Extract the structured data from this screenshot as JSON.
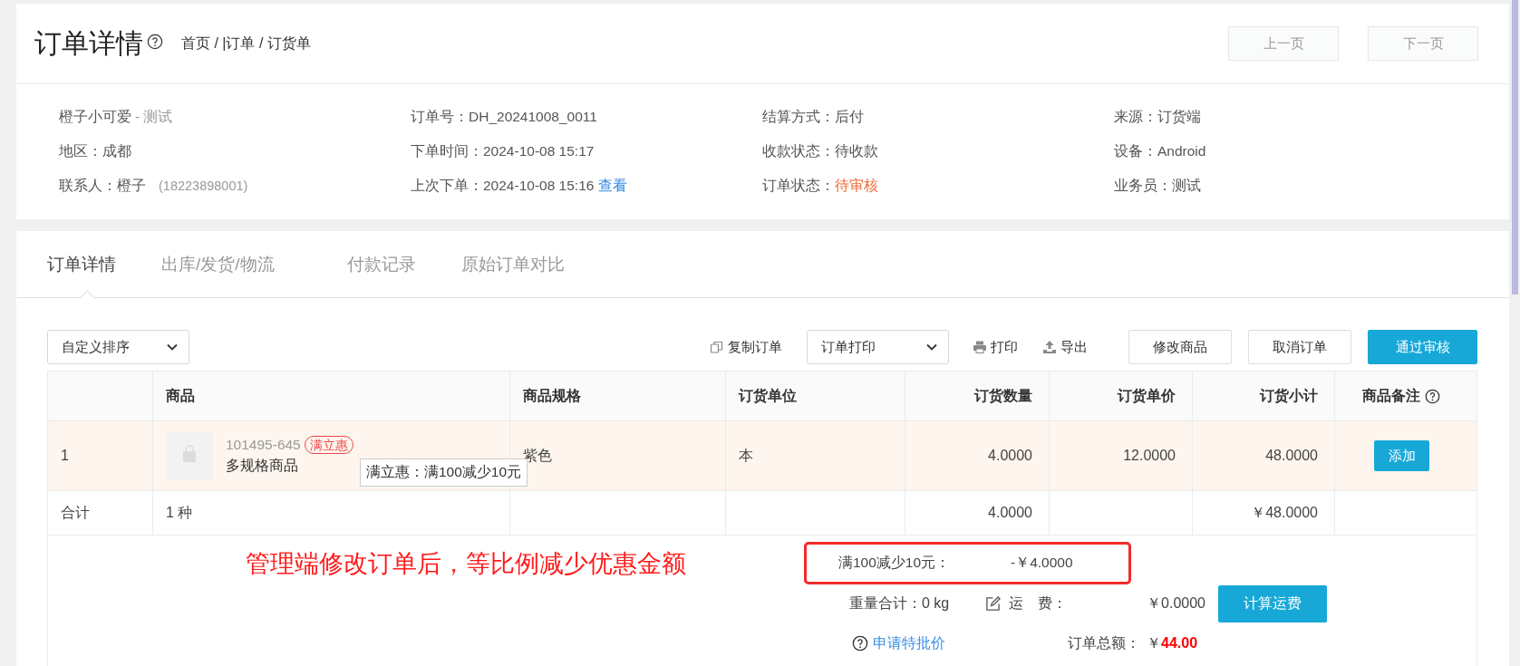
{
  "header": {
    "title": "订单详情",
    "breadcrumb": "首页 / |订单 / 订货单",
    "buttons": [
      "上一页",
      "下一页"
    ]
  },
  "info": [
    {
      "value": "橙子小可爱",
      "note": "- 测试",
      "highlight": false
    },
    {
      "label": "订单号：",
      "value": "DH_20241008_0011",
      "highlight": false
    },
    {
      "label": "结算方式：",
      "value": "后付",
      "highlight": false
    },
    {
      "label": "来源：",
      "value": "订货端",
      "highlight": false
    },
    {
      "label": "地区：",
      "value": "成都",
      "highlight": false
    },
    {
      "label": "下单时间：",
      "value": "2024-10-08 15:17",
      "highlight": false
    },
    {
      "label": "收款状态：",
      "value": "待收款",
      "highlight": false
    },
    {
      "label": "设备：",
      "value": "Android",
      "highlight": false
    },
    {
      "label": "联系人：",
      "value": "橙子",
      "note": "(18223898001)",
      "highlight": false
    },
    {
      "label": "上次下单：",
      "value": "2024-10-08 15:16",
      "link": "查看",
      "highlight": false
    },
    {
      "label": "订单状态：",
      "value": "待审核",
      "highlight": true
    },
    {
      "label": "业务员：",
      "value": "测试",
      "highlight": false
    }
  ],
  "tabs": [
    {
      "label": "订单详情",
      "selected": true
    },
    {
      "label": "出库/发货/物流",
      "selected": false
    },
    {
      "label": "付款记录",
      "selected": false
    },
    {
      "label": "原始订单对比",
      "selected": false
    }
  ],
  "toolbar": {
    "sort": "自定义排序",
    "copy": "复制订单",
    "print_select": "订单打印",
    "print": "打印",
    "export": "导出",
    "buttons": [
      {
        "label": "修改商品",
        "kind": "default"
      },
      {
        "label": "取消订单",
        "kind": "default"
      },
      {
        "label": "通过审核",
        "kind": "primary"
      }
    ]
  },
  "table": {
    "columns": [
      "商品",
      "商品规格",
      "订货单位",
      "订货数量",
      "订货单价",
      "订货小计",
      "商品备注"
    ],
    "rows": [
      {
        "index": "1",
        "sku": "101495-645",
        "tag": "满立惠",
        "name": "多规格商品",
        "spec": "紫色",
        "unit": "本",
        "qty": "4.0000",
        "price": "12.0000",
        "subtotal": "48.0000",
        "action": "添加",
        "selected": true,
        "tooltip": "满立惠：满100减少10元"
      }
    ],
    "total": {
      "label": "合计",
      "kinds": "1 种",
      "qty": "4.0000",
      "subtotal": "￥48.0000"
    }
  },
  "annotation": "管理端修改订单后，等比例减少优惠金额",
  "summary": {
    "discount_label": "满100减少10元：",
    "discount_value": "-￥4.0000",
    "weight": "重量合计：0 kg",
    "freight_label": "运　费：",
    "freight_value": "￥0.0000",
    "freight_button": "计算运费",
    "special_price_link": "申请特批价",
    "total_label": "订单总额：",
    "currency": "￥",
    "total_amount": "44.00"
  }
}
